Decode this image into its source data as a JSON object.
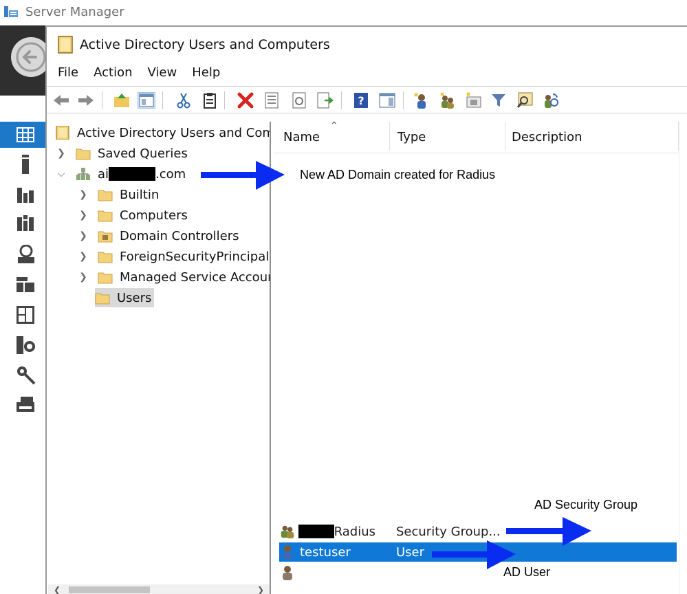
{
  "server_manager": {
    "title": "Server Manager",
    "nav_icons": [
      "dashboard-icon",
      "local-server-icon",
      "all-servers-icon",
      "ad-ds-icon",
      "dns-icon",
      "file-services-icon",
      "hyper-v-icon",
      "iis-icon",
      "nps-icon",
      "print-services-icon"
    ]
  },
  "aduc": {
    "title": "Active Directory Users and Computers",
    "menu": [
      "File",
      "Action",
      "View",
      "Help"
    ],
    "toolbar": [
      "back-icon",
      "forward-icon",
      "up-icon",
      "show-hide-console-tree-icon",
      "cut-icon",
      "paste-icon",
      "delete-icon",
      "properties-icon",
      "refresh-icon",
      "export-list-icon",
      "help-icon",
      "show-action-pane-icon",
      "new-user-icon",
      "new-group-icon",
      "new-ou-icon",
      "filter-icon",
      "find-icon",
      "add-to-group-icon"
    ]
  },
  "tree": {
    "root": "Active Directory Users and Com",
    "saved_queries": "Saved Queries",
    "domain_prefix": "ai",
    "domain_suffix": ".com",
    "children": [
      "Builtin",
      "Computers",
      "Domain Controllers",
      "ForeignSecurityPrincipals",
      "Managed Service Accour",
      "Users"
    ]
  },
  "list": {
    "headers": {
      "name": "Name",
      "type": "Type",
      "description": "Description"
    },
    "rows": [
      {
        "name": "Radius",
        "type": "Security Group...",
        "icon": "security-group-icon",
        "redacted": true
      },
      {
        "name": "testuser",
        "type": "User",
        "icon": "user-icon",
        "selected": true
      },
      {
        "name": "",
        "type": "",
        "icon": "user-icon"
      }
    ]
  },
  "annotations": {
    "domain_note": "New AD Domain created for Radius",
    "group_note": "AD Security Group",
    "user_note": "AD User",
    "arrow_color": "#0a2cf0"
  },
  "colors": {
    "selection_blue": "#1078d7",
    "nav_active": "#1e78c8",
    "folder_yellow": "#f3d27a"
  }
}
